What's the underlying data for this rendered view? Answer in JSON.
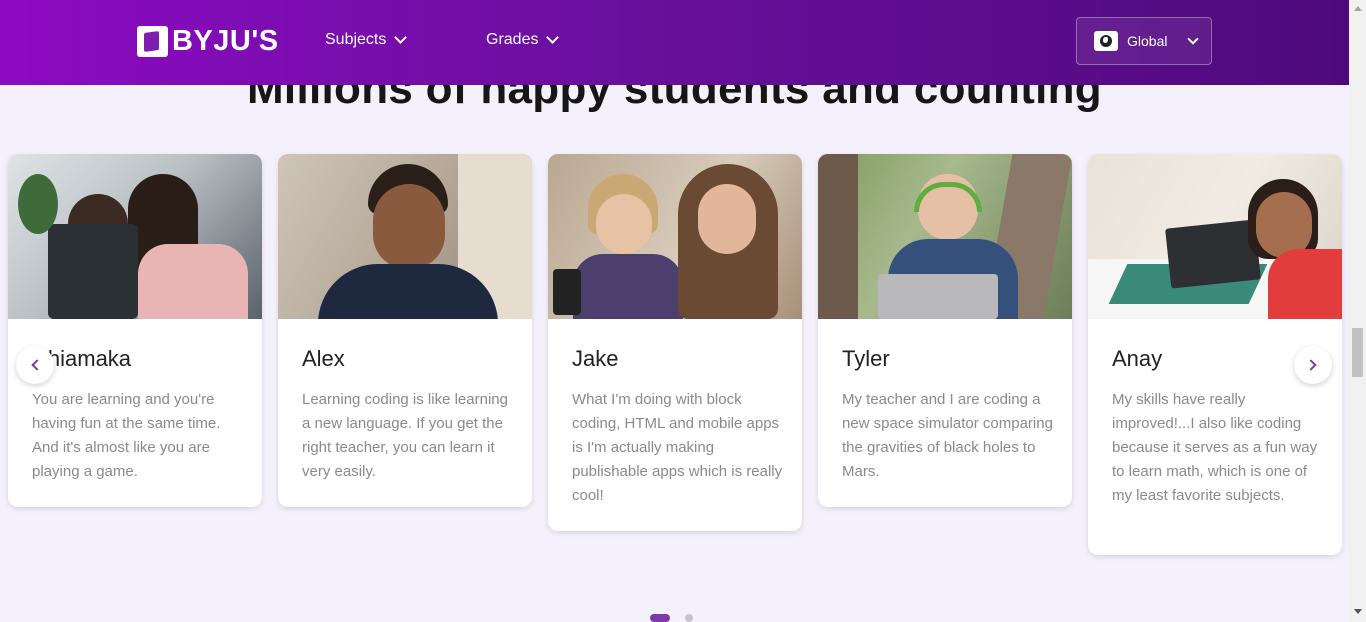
{
  "header": {
    "logo_text": "BYJU'S",
    "nav": [
      {
        "label": "Subjects"
      },
      {
        "label": "Grades"
      }
    ],
    "region": {
      "label": "Global",
      "icon": "globe-icon"
    }
  },
  "section": {
    "title": "Millions of happy students and counting"
  },
  "testimonials": [
    {
      "name": "Chiamaka",
      "quote": "You are learning and you're having fun at the same time. And it's almost like you are playing a game.",
      "photo": "girl-at-laptop"
    },
    {
      "name": "Alex",
      "quote": "Learning coding is like learning a new language. If you get the right teacher, you can learn it very easily.",
      "photo": "teen-boy-portrait"
    },
    {
      "name": "Jake",
      "quote": "What I'm doing with block coding, HTML and mobile apps is I'm actually making publishable apps which is really cool!",
      "photo": "boy-with-mother"
    },
    {
      "name": "Tyler",
      "quote": "My teacher and I are coding a new space simulator comparing the gravities of black holes to Mars.",
      "photo": "boy-with-headphones-laptop"
    },
    {
      "name": "Anay",
      "quote": "My skills have really improved!...I also like coding because it serves as a fun way to learn math, which is one of my least favorite subjects.",
      "photo": "boy-at-desk-laptop"
    }
  ],
  "carousel": {
    "prev_icon": "chevron-left-icon",
    "next_icon": "chevron-right-icon",
    "pages": 2,
    "active_page": 1
  },
  "colors": {
    "header_start": "#8d0ac3",
    "header_end": "#4e0a7c",
    "accent": "#7b3aa6",
    "page_bg": "#f4f1fc"
  }
}
